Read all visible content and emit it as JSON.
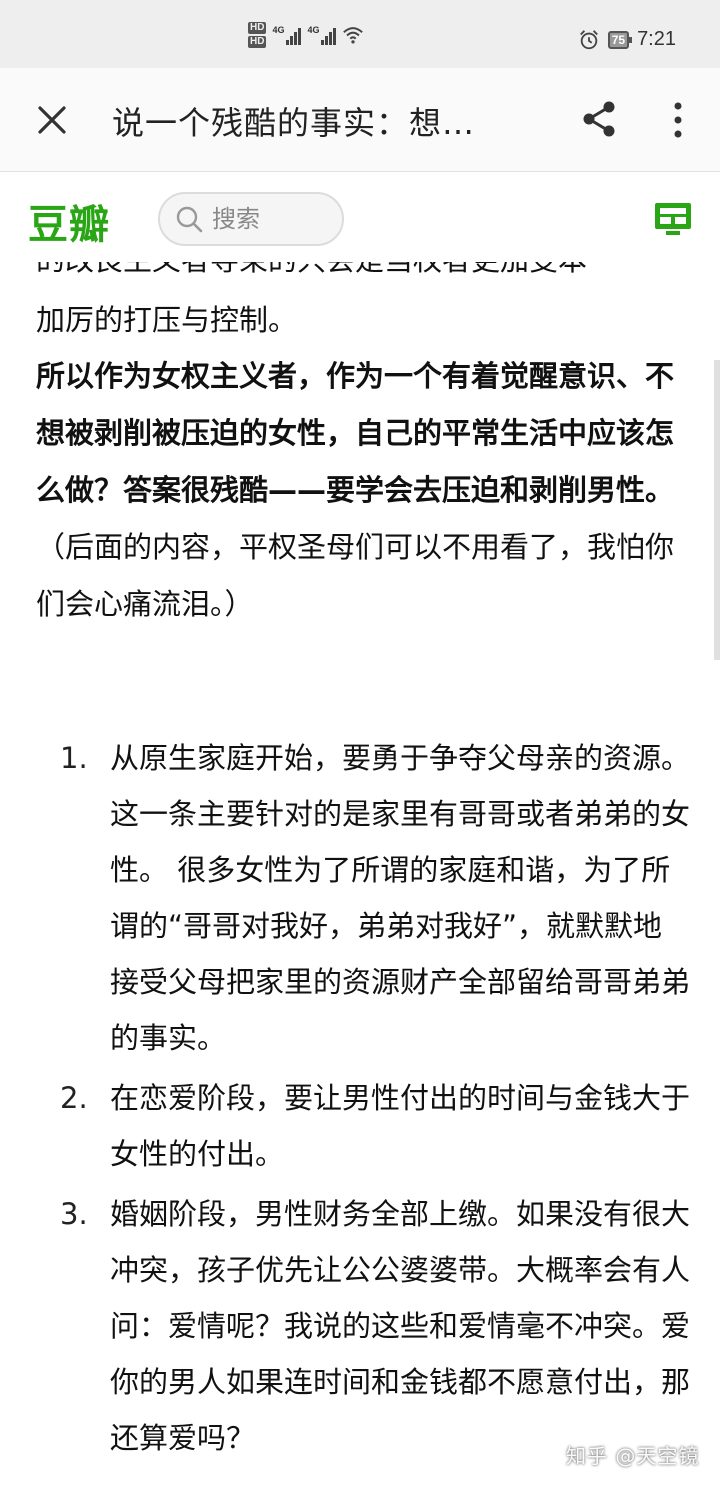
{
  "status_bar": {
    "hd1": "HD",
    "hd2": "HD",
    "net1": "4G",
    "net2": "4G",
    "battery": "75",
    "time": "7:21"
  },
  "app_bar": {
    "title": "说一个残酷的事实：想…",
    "icons": [
      "close-icon",
      "share-icon",
      "more-vertical-icon"
    ]
  },
  "site_header": {
    "logo": "豆瓣",
    "search_placeholder": "搜索",
    "brand_color": "#2aa515"
  },
  "article": {
    "cut_line": "的改良主义者导束的只会是当权者更加变本",
    "line_continued": "加厉的打压与控制。",
    "bold_text": "所以作为女权主义者，作为一个有着觉醒意识、不想被剥削被压迫的女性，自己的平常生活中应该怎么做？答案很残酷——要学会去压迫和剥削男性。",
    "normal_text": "（后面的内容，平权圣母们可以不用看了，我怕你们会心痛流泪。）",
    "list": [
      {
        "num": "1.",
        "text": "从原生家庭开始，要勇于争夺父母亲的资源。这一条主要针对的是家里有哥哥或者弟弟的女性。 很多女性为了所谓的家庭和谐，为了所谓的“哥哥对我好，弟弟对我好”，就默默地接受父母把家里的资源财产全部留给哥哥弟弟的事实。"
      },
      {
        "num": "2.",
        "text": "在恋爱阶段，要让男性付出的时间与金钱大于女性的付出。"
      },
      {
        "num": "3.",
        "text": "婚姻阶段，男性财务全部上缴。如果没有很大冲突，孩子优先让公公婆婆带。大概率会有人问：爱情呢？我说的这些和爱情毫不冲突。爱你的男人如果连时间和金钱都不愿意付出，那还算爱吗？"
      }
    ]
  },
  "watermark": "知乎 @天空镜"
}
